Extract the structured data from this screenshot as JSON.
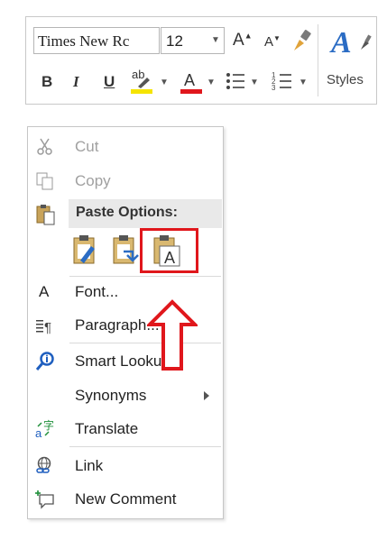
{
  "toolbar": {
    "font_name": "Times New Rc",
    "font_size": "12",
    "bold": "B",
    "italic": "I",
    "underline": "U",
    "highlight_glyph": "ab",
    "font_color_glyph": "A",
    "grow_font": "A",
    "shrink_font": "A",
    "styles_glyph": "A",
    "styles_label": "Styles",
    "highlight_color": "#f5e400",
    "font_color": "#e0171c"
  },
  "menu": {
    "cut": "Cut",
    "copy": "Copy",
    "paste_options": "Paste Options:",
    "font": "Font...",
    "paragraph": "Paragraph...",
    "smart_lookup": "Smart Lookup",
    "synonyms": "Synonyms",
    "translate": "Translate",
    "link": "Link",
    "new_comment": "New Comment"
  },
  "annotation": {
    "color": "#e0171c"
  }
}
